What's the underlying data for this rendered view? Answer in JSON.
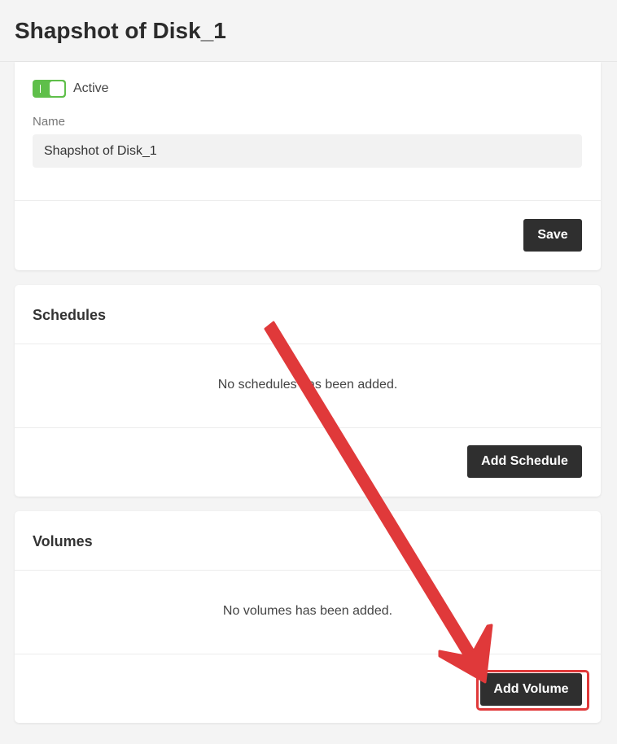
{
  "header": {
    "title": "Shapshot of Disk_1"
  },
  "general": {
    "active_label": "Active",
    "active": true,
    "name_label": "Name",
    "name_value": "Shapshot of Disk_1",
    "save_label": "Save"
  },
  "schedules": {
    "title": "Schedules",
    "empty_text": "No schedules has been added.",
    "add_label": "Add Schedule"
  },
  "volumes": {
    "title": "Volumes",
    "empty_text": "No volumes has been added.",
    "add_label": "Add Volume"
  },
  "colors": {
    "background": "#f4f4f4",
    "toggle_on": "#5fbf4a",
    "button": "#2f2f2f",
    "annotation": "#e0393a"
  }
}
